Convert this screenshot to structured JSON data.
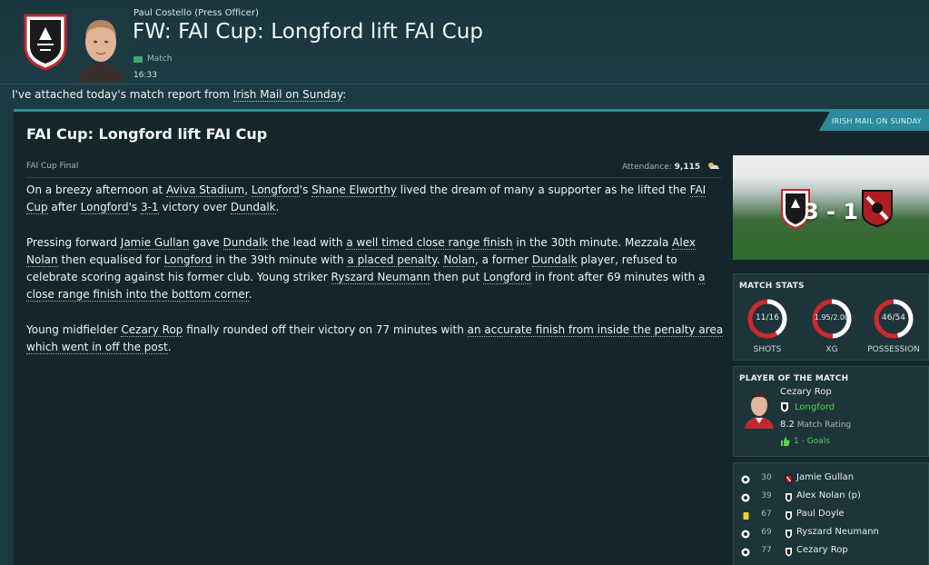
{
  "header": {
    "sender": "Paul Costello  (Press Officer)",
    "title": "FW: FAI Cup: Longford lift FAI Cup",
    "tag": "Match",
    "time": "16:33"
  },
  "intro": {
    "prefix": "I've attached today's match report from ",
    "source_link": "Irish Mail on Sunday",
    "suffix": ":"
  },
  "article": {
    "source_tab": "IRISH MAIL ON SUNDAY",
    "title": "FAI Cup: Longford lift FAI Cup",
    "competition": "FAI Cup Final",
    "attendance_label": "Attendance:",
    "attendance_value": "9,115",
    "p1": {
      "a": "On a breezy afternoon at ",
      "b": "Aviva Stadium",
      "c": ", ",
      "d": "Longford",
      "e": "'s ",
      "f": "Shane Elworthy",
      "g": " lived the dream of many a supporter as he lifted the ",
      "h": "FAI Cup",
      "i": " after ",
      "j": "Longford",
      "k": "'s ",
      "l": "3-1",
      "m": " victory over ",
      "n": "Dundalk",
      "o": "."
    },
    "p2": {
      "a": "Pressing forward ",
      "b": "Jamie Gullan",
      "c": " gave ",
      "d": "Dundalk",
      "e": " the lead with ",
      "f": "a well timed close range finish",
      "g": " in the 30th minute. Mezzala ",
      "h": "Alex Nolan",
      "i": " then equalised for ",
      "j": "Longford",
      "k": " in the 39th minute with ",
      "l": "a placed penalty",
      "m": ". ",
      "n": "Nolan",
      "o": ", a former ",
      "p": "Dundalk",
      "q": " player, refused to celebrate scoring against his former club. Young striker ",
      "r": "Ryszard Neumann",
      "s": " then put ",
      "t": "Longford",
      "u": " in front after 69 minutes with ",
      "v": "a close range finish into the bottom corner",
      "w": "."
    },
    "p3": {
      "a": "Young midfielder ",
      "b": "Cezary Rop",
      "c": " finally rounded off their victory on 77 minutes with ",
      "d": "an accurate finish from inside the penalty area which went in off the post",
      "e": "."
    }
  },
  "score": {
    "text": "3 - 1",
    "home": "Longford",
    "away": "Dundalk"
  },
  "match_stats": {
    "title": "MATCH STATS",
    "gauges": [
      {
        "value": "11/16",
        "label": "SHOTS",
        "home_fraction": 0.41
      },
      {
        "value": "1.95/2.00",
        "label": "XG",
        "home_fraction": 0.49
      },
      {
        "value": "46/54",
        "label": "POSSESSION",
        "home_fraction": 0.46
      }
    ]
  },
  "potm": {
    "title": "PLAYER OF THE MATCH",
    "name": "Cezary Rop",
    "club": "Longford",
    "rating_value": "8.2",
    "rating_label": "Match Rating",
    "goals": "1 - Goals"
  },
  "events": [
    {
      "minute": "30",
      "player": "Jamie Gullan",
      "type": "goal",
      "team": "away"
    },
    {
      "minute": "39",
      "player": "Alex Nolan (p)",
      "type": "goal",
      "team": "home"
    },
    {
      "minute": "67",
      "player": "Paul Doyle",
      "type": "yellow-card",
      "team": "home"
    },
    {
      "minute": "69",
      "player": "Ryszard Neumann",
      "type": "goal",
      "team": "home"
    },
    {
      "minute": "77",
      "player": "Cezary Rop",
      "type": "goal",
      "team": "home"
    }
  ],
  "colors": {
    "accent": "#2a8c9a",
    "gauge_home": "#ffffff",
    "gauge_away": "#d0282c",
    "positive": "#4fd64a",
    "yellow_card": "#f2d024"
  }
}
